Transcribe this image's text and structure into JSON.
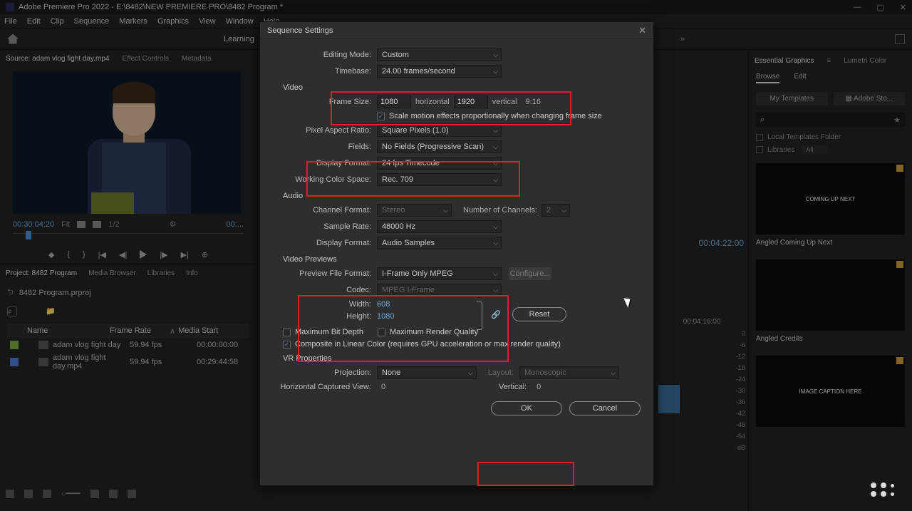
{
  "app": {
    "title": "Adobe Premiere Pro 2022 - E:\\8482\\NEW PREMIERE PRO\\8482 Program *"
  },
  "menu": [
    "File",
    "Edit",
    "Clip",
    "Sequence",
    "Markers",
    "Graphics",
    "View",
    "Window",
    "Help"
  ],
  "workspace": {
    "learning": "Learning"
  },
  "sourceTabs": {
    "source": "Source: adam vlog fight day.mp4",
    "effects": "Effect Controls",
    "metadata": "Metadata"
  },
  "sourceTC": {
    "in": "00:30:04:20",
    "fit": "Fit",
    "half": "1/2",
    "out": "00:..."
  },
  "project": {
    "tabs": {
      "proj": "Project: 8482 Program",
      "media": "Media Browser",
      "libs": "Libraries",
      "info": "Info"
    },
    "crumb": "8482 Program.prproj",
    "cols": {
      "name": "Name",
      "fr": "Frame Rate",
      "ms": "Media Start"
    },
    "rows": [
      {
        "name": "adam vlog fight day",
        "fr": "59.94 fps",
        "ms": "00:00:00:00",
        "color": "#7aaa3a"
      },
      {
        "name": "adam vlog fight day.mp4",
        "fr": "59.94 fps",
        "ms": "00:29:44:58",
        "color": "#4a7ad8"
      }
    ]
  },
  "timeline": {
    "tc": "00:04:22:00",
    "ruler": "00:04:16:00",
    "db": [
      "0",
      "-6",
      "-12",
      "-18",
      "-24",
      "-30",
      "-36",
      "-42",
      "-48",
      "-54",
      "dB"
    ]
  },
  "right": {
    "tabs": {
      "eg": "Essential Graphics",
      "lc": "Lumetri Color"
    },
    "subtabs": {
      "browse": "Browse",
      "edit": "Edit"
    },
    "tmpl": {
      "my": "My Templates",
      "stock": "Adobe Sto..."
    },
    "filters": {
      "local": "Local Templates Folder",
      "libs": "Libraries",
      "all": "All"
    },
    "thumbs": [
      {
        "label": "COMING UP NEXT",
        "caption": "Angled Coming Up Next"
      },
      {
        "label": "",
        "caption": "Angled Credits"
      },
      {
        "label": "IMAGE CAPTION HERE",
        "caption": ""
      }
    ]
  },
  "dialog": {
    "title": "Sequence Settings",
    "editingMode": {
      "label": "Editing Mode:",
      "value": "Custom"
    },
    "timebase": {
      "label": "Timebase:",
      "value": "24.00 frames/second"
    },
    "sections": {
      "video": "Video",
      "audio": "Audio",
      "vp": "Video Previews",
      "vr": "VR Properties"
    },
    "frameSize": {
      "label": "Frame Size:",
      "w": "1080",
      "hLabel": "horizontal",
      "h": "1920",
      "vLabel": "vertical",
      "ar": "9:16"
    },
    "scale": "Scale motion effects proportionally when changing frame size",
    "par": {
      "label": "Pixel Aspect Ratio:",
      "value": "Square Pixels (1.0)"
    },
    "fields": {
      "label": "Fields:",
      "value": "No Fields (Progressive Scan)"
    },
    "dispFmt": {
      "label": "Display Format:",
      "value": "24 fps Timecode"
    },
    "colorSpace": {
      "label": "Working Color Space:",
      "value": "Rec. 709"
    },
    "channelFmt": {
      "label": "Channel Format:",
      "value": "Stereo"
    },
    "numCh": {
      "label": "Number of Channels:",
      "value": "2"
    },
    "sampleRate": {
      "label": "Sample Rate:",
      "value": "48000 Hz"
    },
    "audioDisp": {
      "label": "Display Format:",
      "value": "Audio Samples"
    },
    "prevFmt": {
      "label": "Preview File Format:",
      "value": "I-Frame Only MPEG"
    },
    "configure": "Configure...",
    "codec": {
      "label": "Codec:",
      "value": "MPEG I-Frame"
    },
    "width": {
      "label": "Width:",
      "value": "608"
    },
    "height": {
      "label": "Height:",
      "value": "1080"
    },
    "reset": "Reset",
    "maxDepth": "Maximum Bit Depth",
    "maxQual": "Maximum Render Quality",
    "composite": "Composite in Linear Color (requires GPU acceleration or max render quality)",
    "projection": {
      "label": "Projection:",
      "value": "None"
    },
    "layout": {
      "label": "Layout:",
      "value": "Monoscopic"
    },
    "hcv": {
      "label": "Horizontal Captured View:",
      "value": "0"
    },
    "vcv": {
      "label": "Vertical:",
      "value": "0"
    },
    "ok": "OK",
    "cancel": "Cancel"
  }
}
